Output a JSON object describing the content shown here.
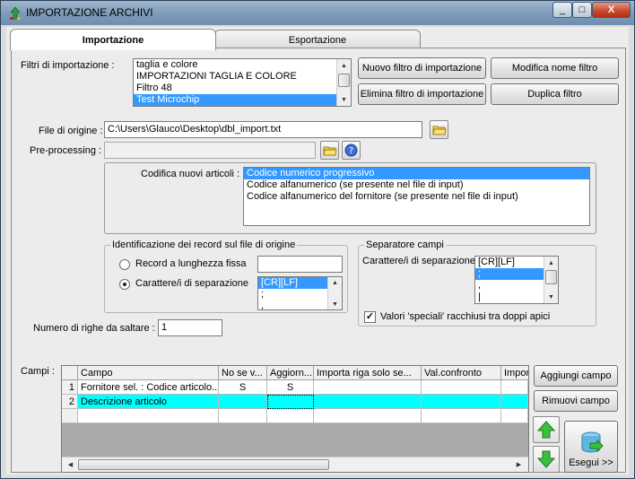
{
  "window": {
    "title": "IMPORTAZIONE ARCHIVI",
    "controls": [
      "_",
      "□",
      "X"
    ]
  },
  "tabs": [
    {
      "label": "Importazione"
    },
    {
      "label": "Esportazione"
    }
  ],
  "filters": {
    "label": "Filtri di importazione :",
    "items": [
      "taglia e colore",
      "IMPORTAZIONI TAGLIA E COLORE",
      "Filtro 48",
      "Test Microchip"
    ],
    "selected_index": 3,
    "buttons": {
      "new": "Nuovo filtro di importazione",
      "rename": "Modifica nome filtro",
      "delete": "Elimina filtro di importazione",
      "duplicate": "Duplica filtro"
    }
  },
  "source_file": {
    "label": "File di origine :",
    "value": "C:\\Users\\Glauco\\Desktop\\dbl_import.txt"
  },
  "preprocessing": {
    "label": "Pre-processing :",
    "value": ""
  },
  "encoding": {
    "label": "Codifica nuovi articoli :",
    "items": [
      "Codice numerico progressivo",
      "Codice alfanumerico (se presente nel file di input)",
      "Codice alfanumerico del fornitore (se presente nel file di input)"
    ],
    "selected_index": 0
  },
  "record_id": {
    "title": "Identificazione dei record sul file di origine",
    "fixed_label": "Record a lunghezza fissa",
    "fixed_value": "",
    "sep_label": "Carattere/i di separazione",
    "sep_items": [
      "[CR][LF]",
      ";",
      ","
    ],
    "selected_option": "separator"
  },
  "field_sep": {
    "title": "Separatore campi",
    "label": "Carattere/i di separazione",
    "items": [
      "[CR][LF]",
      ";",
      ",",
      "|"
    ],
    "selected_index": 1,
    "quoted_label": "Valori 'speciali' racchiusi tra doppi apici",
    "quoted_checked": true
  },
  "skip_rows": {
    "label": "Numero di righe da saltare  :",
    "value": "1"
  },
  "fields": {
    "label": "Campi :",
    "columns": [
      "Campo",
      "No se v...",
      "Aggiorn...",
      "Importa riga solo se...",
      "Val.confronto",
      "Impor"
    ],
    "rows": [
      {
        "num": "1",
        "cells": [
          "Fornitore sel. : Codice articolo...",
          "S",
          "S",
          "",
          "",
          ""
        ]
      },
      {
        "num": "2",
        "cells": [
          "Descrizione articolo",
          "",
          "",
          "",
          "",
          ""
        ]
      }
    ],
    "buttons": {
      "add": "Aggiungi campo",
      "remove": "Rimuovi campo",
      "run": "Esegui >>"
    }
  }
}
